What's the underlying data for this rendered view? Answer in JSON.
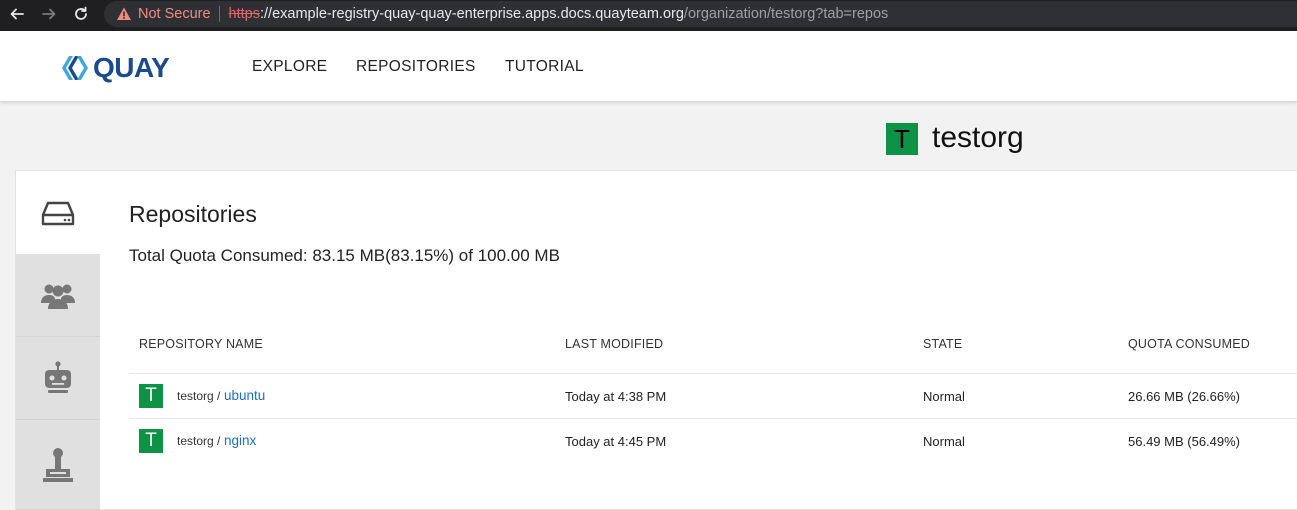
{
  "browser": {
    "security_label": "Not Secure",
    "url_scheme": "https",
    "url_host": "://example-registry-quay-quay-enterprise.apps.docs.quayteam.org",
    "url_path": "/organization/testorg?tab=repos"
  },
  "header": {
    "logo_text": "QUAY",
    "nav": [
      "EXPLORE",
      "REPOSITORIES",
      "TUTORIAL"
    ]
  },
  "org": {
    "avatar_letter": "T",
    "name": "testorg",
    "avatar_color": "#0e9246"
  },
  "main": {
    "title": "Repositories",
    "quota_summary": "Total Quota Consumed: 83.15 MB(83.15%) of 100.00 MB",
    "columns": [
      "REPOSITORY NAME",
      "LAST MODIFIED",
      "STATE",
      "QUOTA CONSUMED"
    ],
    "rows": [
      {
        "avatar_letter": "T",
        "namespace": "testorg /",
        "name": "ubuntu",
        "last_modified": "Today at 4:38 PM",
        "state": "Normal",
        "quota": "26.66 MB (26.66%)"
      },
      {
        "avatar_letter": "T",
        "namespace": "testorg /",
        "name": "nginx",
        "last_modified": "Today at 4:45 PM",
        "state": "Normal",
        "quota": "56.49 MB (56.49%)"
      }
    ]
  },
  "side_tabs": [
    "repositories-icon",
    "teams-icon",
    "robot-accounts-icon",
    "default-permissions-icon"
  ],
  "colors": {
    "link": "#1a6ec2",
    "brand": "#1b4b8f"
  }
}
